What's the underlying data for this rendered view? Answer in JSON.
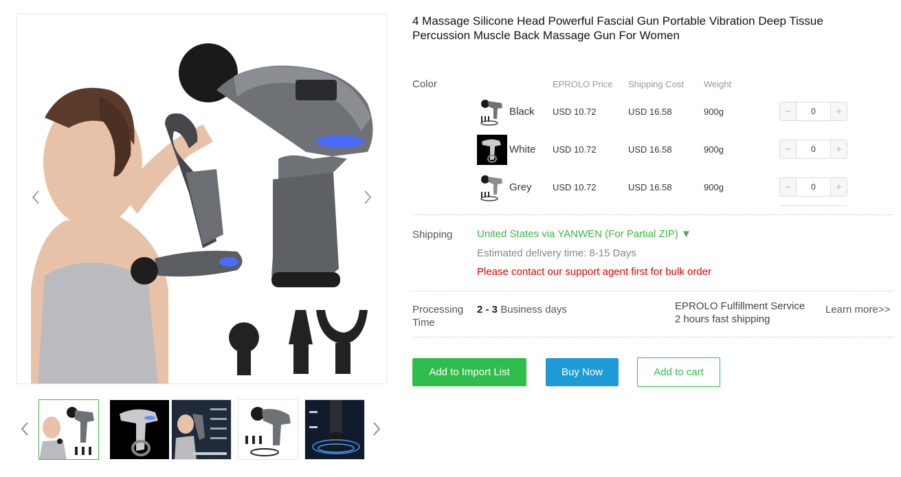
{
  "product": {
    "title": "4 Massage Silicone Head Powerful Fascial Gun Portable Vibration Deep Tissue Percussion Muscle Back Massage Gun For Women"
  },
  "gallery": {
    "prev_icon": "chevron-left-icon",
    "next_icon": "chevron-right-icon",
    "thumbnail_count": 5,
    "active_thumbnail": 1
  },
  "variants": {
    "label": "Color",
    "headers": {
      "price": "EPROLO Price",
      "shipping": "Shipping Cost",
      "weight": "Weight"
    },
    "rows": [
      {
        "name": "Black",
        "price": "USD 10.72",
        "shipping": "USD 16.58",
        "weight": "900g",
        "qty": "0"
      },
      {
        "name": "White",
        "price": "USD 10.72",
        "shipping": "USD 16.58",
        "weight": "900g",
        "qty": "0"
      },
      {
        "name": "Grey",
        "price": "USD 10.72",
        "shipping": "USD 16.58",
        "weight": "900g",
        "qty": "0"
      }
    ],
    "minus": "−",
    "plus": "+"
  },
  "shipping": {
    "label": "Shipping",
    "method": "United States via YANWEN (For Partial ZIP) ▼",
    "delivery": "Estimated delivery time: 8-15 Days",
    "bulk_notice": "Please contact our support agent first for bulk order"
  },
  "processing": {
    "label": "Processing Time",
    "days_bold": "2 - 3",
    "days_text": "Business days",
    "service_line1": "EPROLO Fulfillment Service",
    "service_line2": "2 hours fast shipping",
    "learn_more": "Learn more>>"
  },
  "actions": {
    "import": "Add to Import List",
    "buy": "Buy Now",
    "cart": "Add to cart"
  },
  "colors": {
    "green": "#2fbd4c",
    "blue": "#1e9bd7",
    "red": "#e00000",
    "link_green": "#3cb544"
  }
}
